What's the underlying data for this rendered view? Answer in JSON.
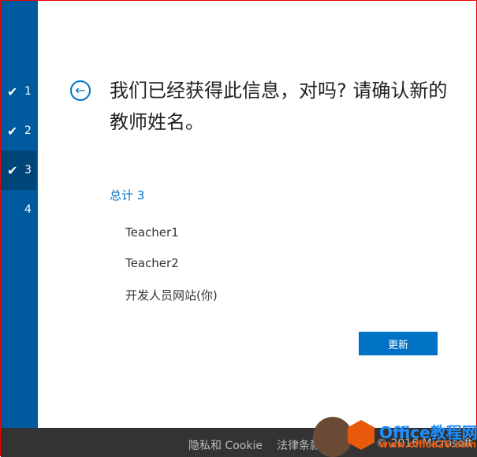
{
  "steps": [
    {
      "num": "1",
      "done": true
    },
    {
      "num": "2",
      "done": true
    },
    {
      "num": "3",
      "done": true,
      "active": true
    },
    {
      "num": "4",
      "done": false
    }
  ],
  "title": "我们已经获得此信息，对吗? 请确认新的教师姓名。",
  "total": "总计 3",
  "items": [
    "Teacher1",
    "Teacher2",
    "开发人员网站(你)"
  ],
  "update_label": "更新",
  "footer": {
    "privacy": "隐私和 Cookie",
    "legal": "法律条款",
    "copyright": "© 2016 Microsoft"
  },
  "watermark": {
    "name": "Office教程网",
    "url": "www.office26.com"
  },
  "colors": {
    "sidebar": "#005a9e",
    "accent": "#0072c6",
    "footer": "#333333"
  }
}
